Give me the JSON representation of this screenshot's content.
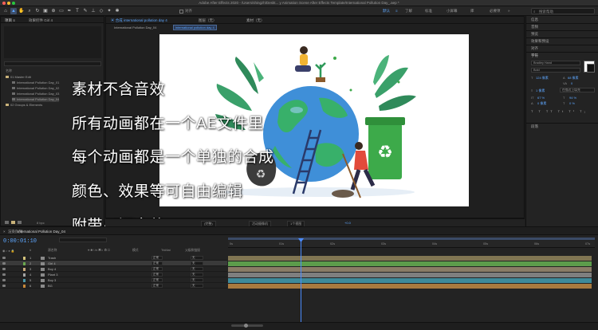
{
  "window": {
    "title": "Adobe After Effects 2020 - /Users/shingzh/Deskt... y Animation Scene After Effects Template/International Pollution Day_.aep *",
    "light_colors": [
      "#ff5f57",
      "#febc2e",
      "#28c840"
    ]
  },
  "toolbar": {
    "tools": [
      "home-icon",
      "selection-tool-icon",
      "hand-tool-icon",
      "rotate-tool-icon",
      "camera-tool-icon",
      "pan-behind-icon",
      "mask-rect-icon",
      "pen-tool-icon",
      "type-tool-icon",
      "brush-tool-icon",
      "clone-stamp-icon",
      "eraser-icon",
      "roto-brush-icon",
      "puppet-pin-icon"
    ],
    "align_label": "对齐",
    "workspaces": [
      "默认",
      "了解",
      "标准",
      "小屏幕",
      "库"
    ],
    "active_workspace": "默认",
    "extra_label": "必要项",
    "search_placeholder": "搜索帮助"
  },
  "project_panel": {
    "tab_project": "项目 ≡",
    "tab_effects": "效果控件 Girl 4",
    "column_name": "名称",
    "items": [
      "01 Master Edit",
      "International Pollution Day_01",
      "International Pollution Day_02",
      "International Pollution Day_03",
      "International Pollution Day_04",
      "02 Groups & Elements"
    ],
    "footer": "8 bpc"
  },
  "viewer": {
    "tab_comp": "合成 international pollution day 4",
    "tab_layer": "图层（无）",
    "tab_footage": "素材（无）",
    "breadcrumb_1": "International Pollution Day_04",
    "breadcrumb_2": "international pollution day 4",
    "zoom": "(完整)",
    "camera": "活动摄像机",
    "views": "1个视图",
    "offset": "+0.0"
  },
  "overlay_lines": [
    "素材不含音效",
    "所有动画都在一个AE文件里",
    "每个动画都是一个单独的合成",
    "颜色、效果等可自由编辑",
    "附带AI源文件"
  ],
  "right_panel": {
    "info": "信息",
    "audio": "音频",
    "preview": "预览",
    "effects_presets": "效果和预设",
    "align": "对齐",
    "character": "字符",
    "font": "Bradley Hand",
    "style": "Bold",
    "size": "124 像素",
    "leading": "68 像素",
    "tracking": "0",
    "stroke": "1 像素",
    "stroke_mode": "在描边上填充",
    "v_scale": "67 %",
    "h_scale": "94 %",
    "baseline": "0 像素",
    "tsume": "0 %",
    "paragraph": "段落"
  },
  "timeline": {
    "tab_render": "渲染队列",
    "tab_comp": "International Pollution Day_04",
    "timecode": "0:00:01:10",
    "columns": {
      "source": "源名称",
      "mode": "模式",
      "trkmat": "TrkMat",
      "parent": "父级和链接"
    },
    "layers": [
      {
        "num": "1",
        "name": "Trash",
        "color": "#d3c27a",
        "mode": "正常",
        "parent": "无"
      },
      {
        "num": "2",
        "name": "Girl 4",
        "color": "#6aa84f",
        "mode": "正常",
        "parent": "无"
      },
      {
        "num": "3",
        "name": "Boy 4",
        "color": "#c9a97a",
        "mode": "正常",
        "parent": "无"
      },
      {
        "num": "4",
        "name": "Plant 3",
        "color": "#a4a4a4",
        "mode": "正常",
        "parent": "无"
      },
      {
        "num": "5",
        "name": "Boy 3",
        "color": "#4a98a8",
        "mode": "正常",
        "parent": "无"
      },
      {
        "num": "6",
        "name": "BG",
        "color": "#c7883a",
        "mode": "正常",
        "parent": "无"
      }
    ],
    "ruler_ticks": [
      "0s",
      "01s",
      "02s",
      "03s",
      "04s",
      "05s",
      "06s",
      "07s"
    ],
    "track_colors": [
      "#807552",
      "#5c9c4b",
      "#8a7c66",
      "#7f7f7f",
      "#3e8a9a",
      "#a87a3f"
    ]
  }
}
